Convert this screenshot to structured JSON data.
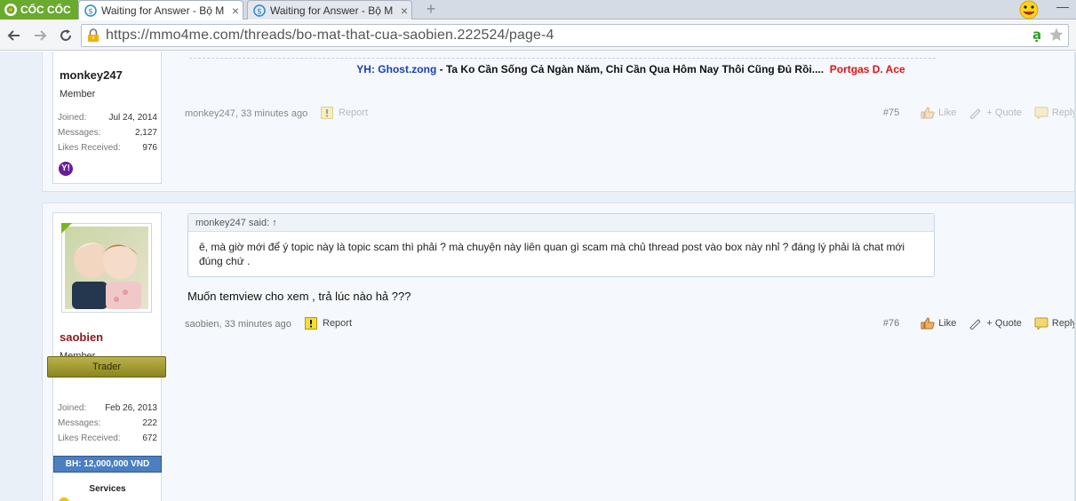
{
  "browser": {
    "brand": "CỐC CỐC",
    "tabs": [
      {
        "title": "Waiting for Answer - Bộ M",
        "close": "×"
      },
      {
        "title": "Waiting for Answer - Bộ M",
        "close": "×"
      }
    ],
    "new_tab": "+",
    "minimize": "—",
    "url": "https://mmo4me.com/threads/bo-mat-that-cua-saobien.222524/page-4"
  },
  "posts": [
    {
      "username": "monkey247",
      "usertitle": "Member",
      "stats": [
        {
          "label": "Joined:",
          "value": "Jul 24, 2014"
        },
        {
          "label": "Messages:",
          "value": "2,127"
        },
        {
          "label": "Likes Received:",
          "value": "976"
        }
      ],
      "im_icon_label": "Y!",
      "signature": {
        "yh": "YH: Ghost.zong",
        "middle": " - Ta Ko Cần Sống Cả Ngàn Năm, Chỉ Cần Qua Hôm Nay Thôi Cũng Đủ Rồi....",
        "portgas": "Portgas D. Ace"
      },
      "meta": {
        "author_time": "monkey247, 33 minutes ago",
        "report": "Report",
        "number": "#75",
        "like": "Like",
        "quote": "+ Quote",
        "reply": "Reply"
      }
    },
    {
      "username": "saobien",
      "usertitle": "Member",
      "badge": "Trader",
      "stats": [
        {
          "label": "Joined:",
          "value": "Feb 26, 2013"
        },
        {
          "label": "Messages:",
          "value": "222"
        },
        {
          "label": "Likes Received:",
          "value": "672"
        }
      ],
      "bh": "BH: 12,000,000 VND",
      "services": "Services",
      "quote": {
        "header": "monkey247 said: ↑",
        "body": "ê, mà giờ mới để ý topic này là topic scam thì phải ? mà chuyện này liên quan gì scam mà chủ thread post vào box này nhỉ ? đáng lý phải là chat mới đúng chứ ."
      },
      "message": "Muốn temview cho xem , trả lúc nào hả ???",
      "meta": {
        "author_time": "saobien, 33 minutes ago",
        "report": "Report",
        "number": "#76",
        "like": "Like",
        "quote": "+ Quote",
        "reply": "Reply"
      }
    }
  ],
  "colors": {
    "brand_green": "#6aaa2e",
    "username_red": "#8b1a1a",
    "trader_gold": "#a29b34",
    "bh_blue": "#4b7fc0",
    "sig_blue": "#1b3fb0",
    "sig_red": "#d41818"
  }
}
